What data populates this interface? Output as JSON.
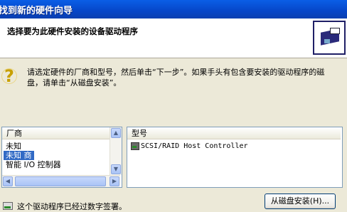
{
  "window": {
    "title": "找到新的硬件向导"
  },
  "header": {
    "title": "选择要为此硬件安装的设备驱动程序",
    "icon": "hardware-icon"
  },
  "instructions": "请选定硬件的厂商和型号，然后单击“下一步”。如果手头有包含要安装的驱动程序的磁盘，请单击“从磁盘安装”。",
  "manufacturer": {
    "header": "厂商",
    "items": [
      {
        "label": "未知"
      },
      {
        "label": "未知 商"
      },
      {
        "label": "智能 I/O 控制器"
      }
    ],
    "selected": "未知 商"
  },
  "model": {
    "header": "型号",
    "items": [
      {
        "label": "SCSI/RAID Host Controller"
      }
    ]
  },
  "signature": {
    "text": "这个驱动程序已经过数字签署。"
  },
  "buttons": {
    "have_disk": "从磁盘安装(H)..."
  },
  "colors": {
    "titlebar": "#0a5fe6",
    "selection": "#316ac5",
    "dialog": "#ece9d8"
  }
}
